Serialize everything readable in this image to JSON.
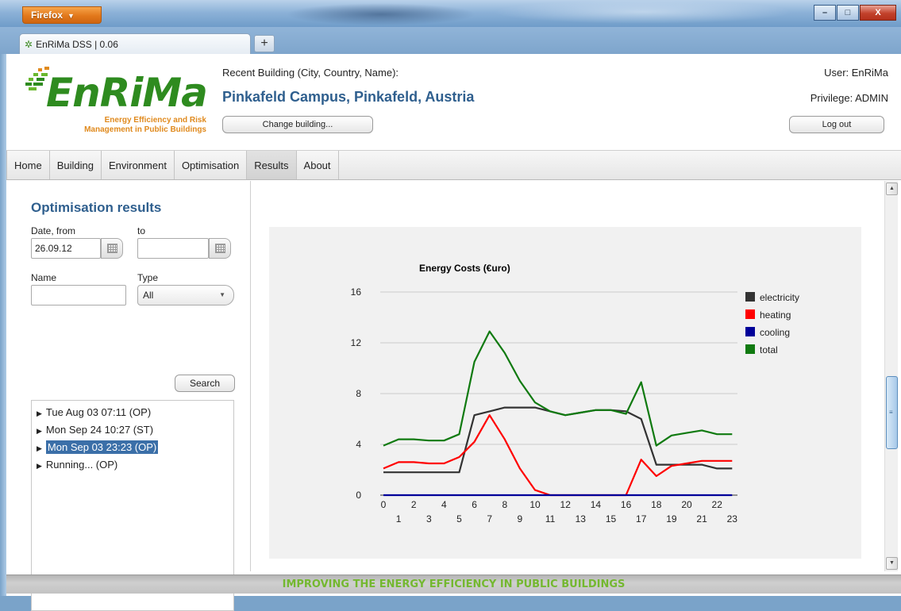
{
  "browser": {
    "menu_label": "Firefox",
    "tab_title": "EnRiMa DSS | 0.06",
    "new_tab_label": "+",
    "window_buttons": {
      "minimize": "–",
      "maximize": "□",
      "close": "X"
    }
  },
  "header": {
    "logo_wordmark": "EnRiMa",
    "logo_tagline_1": "Energy Efficiency and Risk",
    "logo_tagline_2": "Management in Public Buildings",
    "recent_label": "Recent Building (City, Country, Name):",
    "building_name": "Pinkafeld Campus, Pinkafeld, Austria",
    "change_button": "Change building...",
    "user": "User: EnRiMa",
    "privilege": "Privilege: ADMIN",
    "logout_button": "Log out"
  },
  "nav": {
    "items": [
      "Home",
      "Building",
      "Environment",
      "Optimisation",
      "Results",
      "About"
    ],
    "active_index": 4
  },
  "sidebar": {
    "title": "Optimisation results",
    "date_from_label": "Date, from",
    "date_from_value": "26.09.12",
    "to_label": "to",
    "to_value": "",
    "name_label": "Name",
    "name_value": "",
    "type_label": "Type",
    "type_value": "All",
    "search_button": "Search",
    "results": [
      {
        "label": "Tue Aug 03 07:11 (OP)",
        "selected": false
      },
      {
        "label": "Mon Sep 24 10:27 (ST)",
        "selected": false
      },
      {
        "label": "Mon Sep 03 23:23 (OP)",
        "selected": true
      },
      {
        "label": "Running... (OP)",
        "selected": false
      }
    ]
  },
  "footer": {
    "text": "IMPROVING THE ENERGY EFFICIENCY IN PUBLIC BUILDINGS"
  },
  "chart_data": {
    "type": "line",
    "title": "Energy Costs (€uro)",
    "xlabel": "",
    "ylabel": "",
    "x": [
      0,
      1,
      2,
      3,
      4,
      5,
      6,
      7,
      8,
      9,
      10,
      11,
      12,
      13,
      14,
      15,
      16,
      17,
      18,
      19,
      20,
      21,
      22,
      23
    ],
    "ylim": [
      0,
      16
    ],
    "yticks": [
      0,
      4,
      8,
      12,
      16
    ],
    "grid": true,
    "legend_position": "right",
    "series": [
      {
        "name": "electricity",
        "color": "#333333",
        "values": [
          1.8,
          1.8,
          1.8,
          1.8,
          1.8,
          1.8,
          6.3,
          6.6,
          6.9,
          6.9,
          6.9,
          6.6,
          6.3,
          6.5,
          6.7,
          6.7,
          6.6,
          6.0,
          2.4,
          2.4,
          2.4,
          2.4,
          2.1,
          2.1
        ]
      },
      {
        "name": "heating",
        "color": "#ff0000",
        "values": [
          2.1,
          2.6,
          2.6,
          2.5,
          2.5,
          3.0,
          4.2,
          6.3,
          4.4,
          2.1,
          0.4,
          0.0,
          0.0,
          0.0,
          0.0,
          0.0,
          0.0,
          2.8,
          1.5,
          2.3,
          2.5,
          2.7,
          2.7,
          2.7
        ]
      },
      {
        "name": "cooling",
        "color": "#000099",
        "values": [
          0,
          0,
          0,
          0,
          0,
          0,
          0,
          0,
          0,
          0,
          0,
          0,
          0,
          0,
          0,
          0,
          0,
          0,
          0,
          0,
          0,
          0,
          0,
          0
        ]
      },
      {
        "name": "total",
        "color": "#107a10",
        "values": [
          3.9,
          4.4,
          4.4,
          4.3,
          4.3,
          4.8,
          10.5,
          12.9,
          11.2,
          9.0,
          7.3,
          6.6,
          6.3,
          6.5,
          6.7,
          6.7,
          6.4,
          8.9,
          3.9,
          4.7,
          4.9,
          5.1,
          4.8,
          4.8
        ]
      }
    ]
  }
}
